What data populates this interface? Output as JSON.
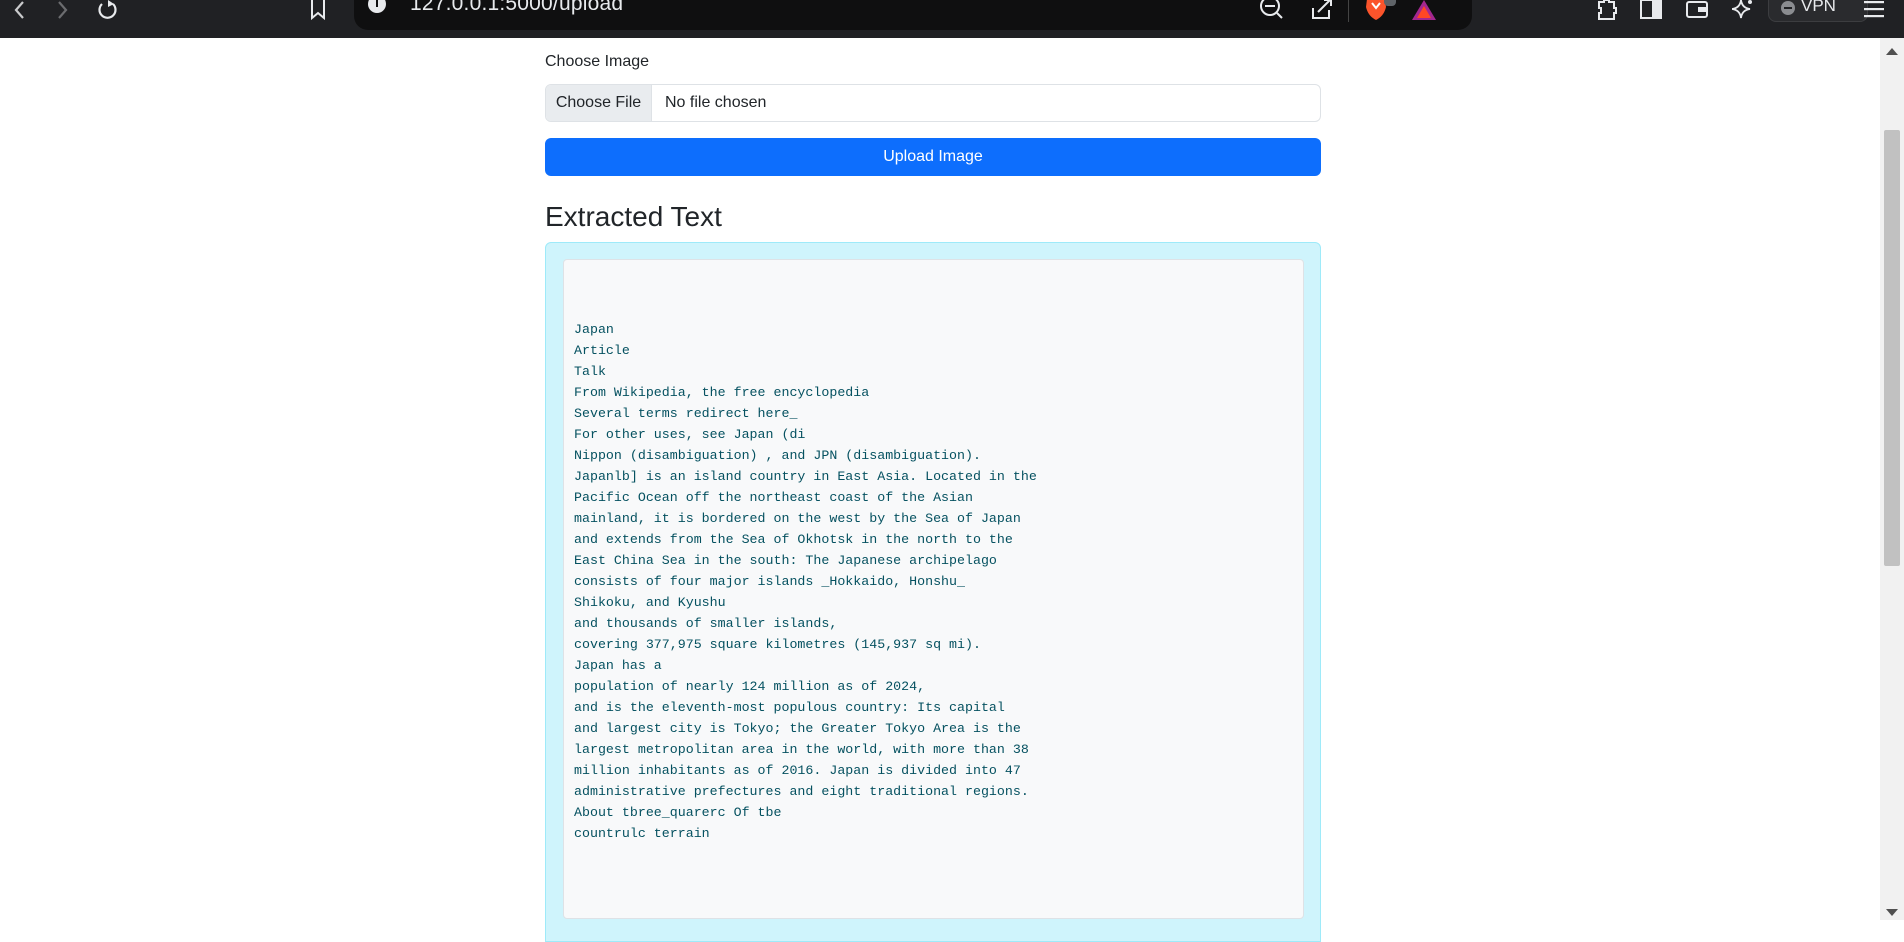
{
  "browser": {
    "url": "127.0.0.1:5000/upload",
    "vpn_label": "VPN",
    "icons": [
      "back-icon",
      "forward-icon",
      "reload-icon",
      "bookmark-icon",
      "site-info-icon",
      "zoom-out-icon",
      "share-icon",
      "brave-shields-icon",
      "brave-rewards-icon",
      "extensions-icon",
      "sidebar-icon",
      "wallet-icon",
      "leo-ai-icon",
      "menu-icon"
    ]
  },
  "form": {
    "label": "Choose Image",
    "file_button": "Choose File",
    "file_status": "No file chosen",
    "upload_button": "Upload Image"
  },
  "result": {
    "heading": "Extracted Text",
    "lines": [
      "Japan",
      "Article",
      "Talk",
      "From Wikipedia, the free encyclopedia",
      "Several terms redirect here_",
      "For other uses, see Japan (di",
      "Nippon (disambiguation) , and JPN (disambiguation).",
      "Japanlb] is an island country in East Asia. Located in the",
      "Pacific Ocean off the northeast coast of the Asian",
      "mainland, it is bordered on the west by the Sea of Japan",
      "and extends from the Sea of Okhotsk in the north to the",
      "East China Sea in the south: The Japanese archipelago",
      "consists of four major islands _Hokkaido, Honshu_",
      "Shikoku, and Kyushu",
      "and thousands of smaller islands,",
      "covering 377,975 square kilometres (145,937 sq mi).",
      "Japan has a",
      "population of nearly 124 million as of 2024,",
      "and is the eleventh-most populous country: Its capital",
      "and largest city is Tokyo; the Greater Tokyo Area is the",
      "largest metropolitan area in the world, with more than 38",
      "million inhabitants as of 2016. Japan is divided into 47",
      "administrative prefectures and eight traditional regions.",
      "About tbree_quarerc Of tbe",
      "countrulc terrain"
    ]
  },
  "colors": {
    "primary": "#0d6efd",
    "info_bg": "#cff4fc",
    "info_text": "#055160",
    "toolbar_bg": "#202124"
  }
}
